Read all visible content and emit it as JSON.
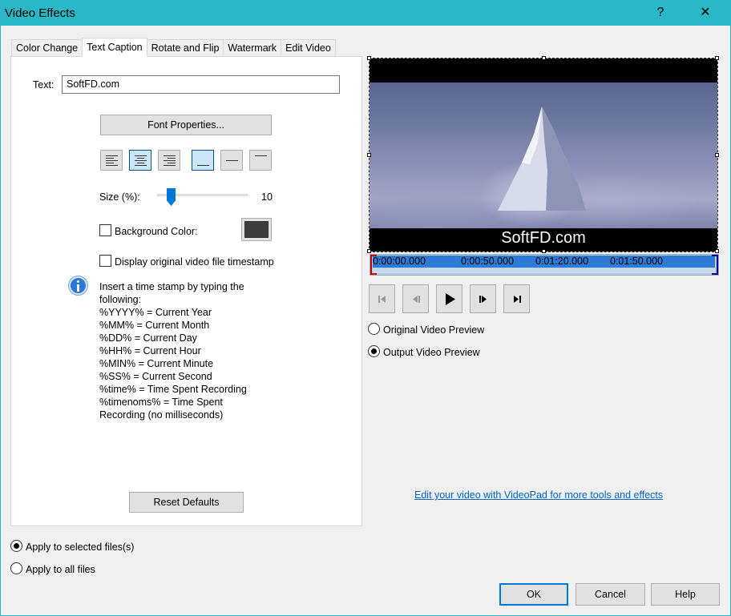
{
  "window": {
    "title": "Video Effects",
    "help_glyph": "?",
    "close_glyph": "✕"
  },
  "tabs": [
    {
      "label": "Color Change"
    },
    {
      "label": "Text Caption"
    },
    {
      "label": "Rotate and Flip"
    },
    {
      "label": "Watermark"
    },
    {
      "label": "Edit Video"
    }
  ],
  "text_caption": {
    "text_label": "Text:",
    "text_value": "SoftFD.com",
    "font_properties_label": "Font Properties...",
    "size_label": "Size (%):",
    "size_value": "10",
    "size_level": 10,
    "background_color_label": "Background Color:",
    "background_color": "#3c3c3c",
    "timestamp_label": "Display original video file timestamp",
    "info_lines": [
      "Insert a time stamp by typing the following:",
      "%YYYY% = Current Year",
      "%MM% = Current Month",
      "%DD% = Current Day",
      "%HH% = Current Hour",
      "%MIN% = Current Minute",
      "%SS% = Current Second",
      "%time% = Time Spent Recording",
      "%timenoms% = Time Spent Recording (no milliseconds)"
    ],
    "reset_label": "Reset Defaults"
  },
  "preview": {
    "caption": "SoftFD.com",
    "timeline_labels": [
      "0:00:00.000",
      "0:00:50.000",
      "0:01:20.000",
      "0:01:50.000"
    ],
    "original_label": "Original Video Preview",
    "output_label": "Output Video Preview",
    "selected_mode": "output"
  },
  "apply": {
    "selected_label": "Apply to selected files(s)",
    "all_label": "Apply to all files",
    "selected_option": "selected"
  },
  "link_text": "Edit your video with VideoPad for more tools and effects",
  "buttons": {
    "ok": "OK",
    "cancel": "Cancel",
    "help": "Help"
  },
  "colors": {
    "titlebar": "#2bb8c6",
    "accent": "#0078d7",
    "link": "#0066cc"
  }
}
